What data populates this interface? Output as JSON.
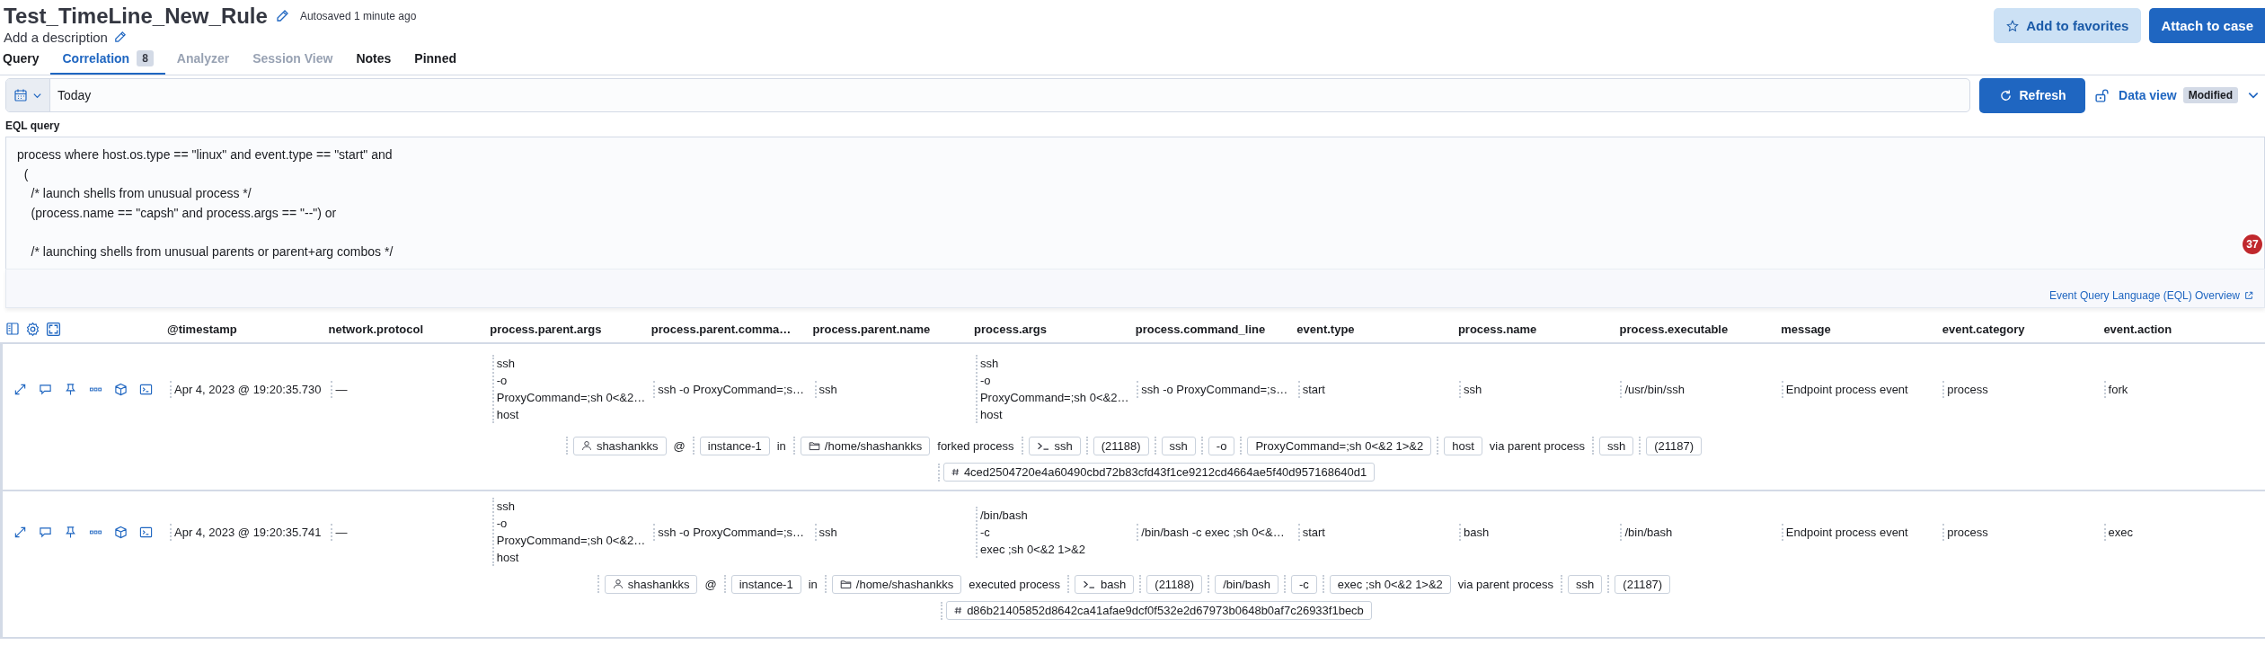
{
  "header": {
    "title": "Test_TimeLine_New_Rule",
    "autosave": "Autosaved 1 minute ago",
    "description": "Add a description"
  },
  "actions": [
    {
      "label": "Add to favorites",
      "kind": "secondary"
    },
    {
      "label": "Attach to case",
      "kind": "primary"
    }
  ],
  "tabs": [
    {
      "label": "Query",
      "selected": false,
      "disabled": false
    },
    {
      "label": "Correlation",
      "selected": true,
      "disabled": false,
      "count": "8"
    },
    {
      "label": "Analyzer",
      "selected": false,
      "disabled": true
    },
    {
      "label": "Session View",
      "selected": false,
      "disabled": true
    },
    {
      "label": "Notes",
      "selected": false,
      "disabled": false
    },
    {
      "label": "Pinned",
      "selected": false,
      "disabled": false
    }
  ],
  "date_picker": {
    "value": "Today"
  },
  "refresh_button": "Refresh",
  "data_view": {
    "label": "Data view",
    "badge": "Modified"
  },
  "eql": {
    "label": "EQL query",
    "query": "process where host.os.type == \"linux\" and event.type == \"start\" and\n  (\n    /* launch shells from unusual process */\n    (process.name == \"capsh\" and process.args == \"--\") or\n\n    /* launching shells from unusual parents or parent+arg combos */",
    "help_link": "Event Query Language (EQL) Overview"
  },
  "notification_badge": "37",
  "table": {
    "columns": [
      "@timestamp",
      "network.protocol",
      "process.parent.args",
      "process.parent.comma…",
      "process.parent.name",
      "process.args",
      "process.command_line",
      "event.type",
      "process.name",
      "process.executable",
      "message",
      "event.category",
      "event.action"
    ],
    "rows": [
      {
        "cells": [
          [
            "Apr 4, 2023 @ 19:20:35.730"
          ],
          [
            "—"
          ],
          [
            "ssh",
            "-o",
            "ProxyCommand=;sh 0<&2…",
            "host"
          ],
          [
            "ssh -o ProxyCommand=;s…"
          ],
          [
            "ssh"
          ],
          [
            "ssh",
            "-o",
            "ProxyCommand=;sh 0<&2…",
            "host"
          ],
          [
            "ssh -o ProxyCommand=;s…"
          ],
          [
            "start"
          ],
          [
            "ssh"
          ],
          [
            "/usr/bin/ssh"
          ],
          [
            "Endpoint process event"
          ],
          [
            "process"
          ],
          [
            "fork"
          ]
        ],
        "summary": [
          {
            "kind": "user",
            "text": "shashankks"
          },
          {
            "kind": "text",
            "text": "@"
          },
          {
            "kind": "chip",
            "text": "instance-1"
          },
          {
            "kind": "text",
            "text": "in"
          },
          {
            "kind": "folder",
            "text": "/home/shashankks"
          },
          {
            "kind": "text",
            "text": "forked process"
          },
          {
            "kind": "process",
            "text": "ssh"
          },
          {
            "kind": "chip",
            "text": "(21188)"
          },
          {
            "kind": "chip",
            "text": "ssh"
          },
          {
            "kind": "chip",
            "text": "-o"
          },
          {
            "kind": "chip",
            "text": "ProxyCommand=;sh 0<&2 1>&2"
          },
          {
            "kind": "chip",
            "text": "host"
          },
          {
            "kind": "text",
            "text": "via parent process"
          },
          {
            "kind": "chip",
            "text": "ssh"
          },
          {
            "kind": "chip",
            "text": "(21187)"
          }
        ],
        "hash": "4ced2504720e4a60490cbd72b83cfd43f1ce9212cd4664ae5f40d957168640d1"
      },
      {
        "cells": [
          [
            "Apr 4, 2023 @ 19:20:35.741"
          ],
          [
            "—"
          ],
          [
            "ssh",
            "-o",
            "ProxyCommand=;sh 0<&2…",
            "host"
          ],
          [
            "ssh -o ProxyCommand=;s…"
          ],
          [
            "ssh"
          ],
          [
            "/bin/bash",
            "-c",
            "exec ;sh 0<&2 1>&2"
          ],
          [
            "/bin/bash -c exec ;sh 0<&…"
          ],
          [
            "start"
          ],
          [
            "bash"
          ],
          [
            "/bin/bash"
          ],
          [
            "Endpoint process event"
          ],
          [
            "process"
          ],
          [
            "exec"
          ]
        ],
        "summary": [
          {
            "kind": "user",
            "text": "shashankks"
          },
          {
            "kind": "text",
            "text": "@"
          },
          {
            "kind": "chip",
            "text": "instance-1"
          },
          {
            "kind": "text",
            "text": "in"
          },
          {
            "kind": "folder",
            "text": "/home/shashankks"
          },
          {
            "kind": "text",
            "text": "executed process"
          },
          {
            "kind": "process",
            "text": "bash"
          },
          {
            "kind": "chip",
            "text": "(21188)"
          },
          {
            "kind": "chip",
            "text": "/bin/bash"
          },
          {
            "kind": "chip",
            "text": "-c"
          },
          {
            "kind": "chip",
            "text": "exec ;sh 0<&2 1>&2"
          },
          {
            "kind": "text",
            "text": "via parent process"
          },
          {
            "kind": "chip",
            "text": "ssh"
          },
          {
            "kind": "chip",
            "text": "(21187)"
          }
        ],
        "hash": "d86b21405852d8642ca41afae9dcf0f532e2d67973b0648b0af7c26933f1becb"
      }
    ]
  }
}
